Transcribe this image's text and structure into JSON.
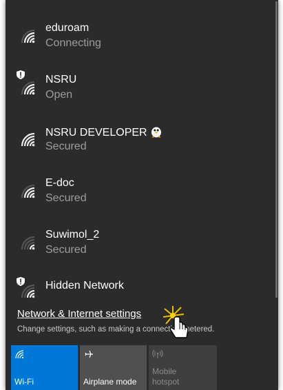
{
  "networks": [
    {
      "name": "eduroam",
      "status": "Connecting",
      "secured_shield": false,
      "signal": 3
    },
    {
      "name": "NSRU",
      "status": "Open",
      "secured_shield": true,
      "signal": 3
    },
    {
      "name": "NSRU DEVELOPER",
      "status": "Secured",
      "secured_shield": false,
      "signal": 4,
      "emoji": "penguin-icon"
    },
    {
      "name": "E-doc",
      "status": "Secured",
      "secured_shield": false,
      "signal": 3
    },
    {
      "name": "Suwimol_2",
      "status": "Secured",
      "secured_shield": false,
      "signal": 1
    },
    {
      "name": "Hidden Network",
      "status": "",
      "secured_shield": true,
      "signal": 2
    }
  ],
  "settings": {
    "link_label": "Network & Internet settings",
    "description": "Change settings, such as making a connection metered."
  },
  "quick_actions": [
    {
      "label": "Wi-Fi",
      "icon": "wifi-icon",
      "active": true,
      "enabled": true
    },
    {
      "label": "Airplane mode",
      "icon": "airplane-icon",
      "active": false,
      "enabled": true
    },
    {
      "label": "Mobile hotspot",
      "icon": "hotspot-icon",
      "active": false,
      "enabled": false
    }
  ],
  "colors": {
    "panel_bg": "#2b2b2b",
    "accent": "#0078d7",
    "tile_inactive": "#505050",
    "tile_disabled": "#3f3f3f",
    "status_text": "#9d9d9d"
  }
}
